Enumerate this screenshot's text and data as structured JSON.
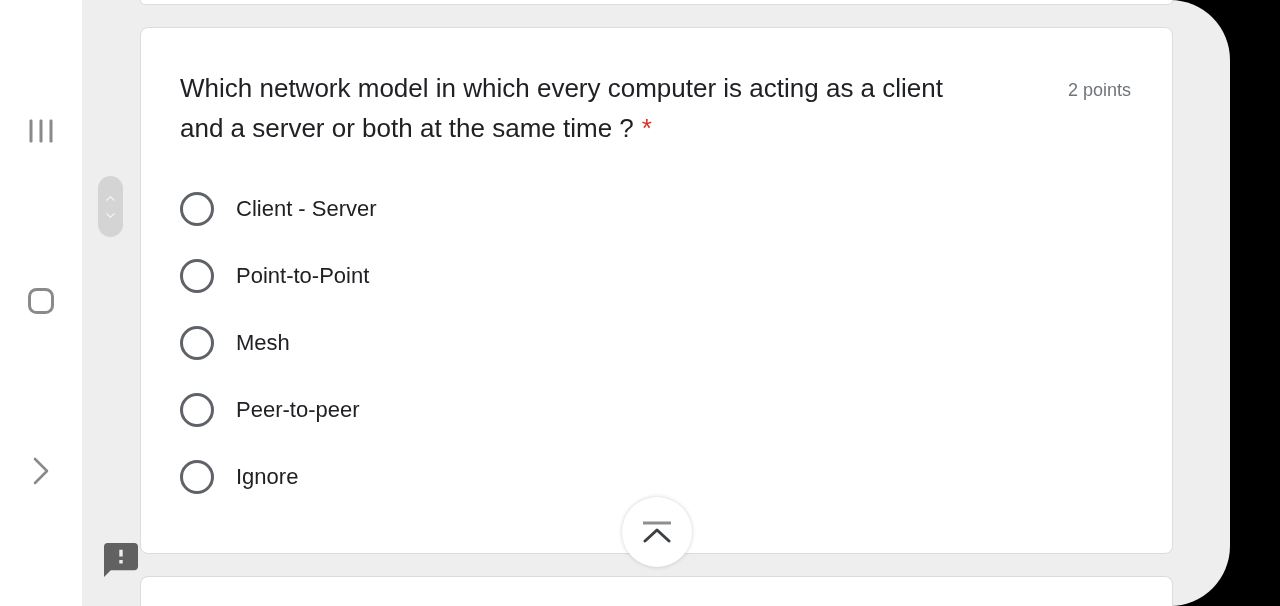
{
  "question": {
    "title": "Which network model in which every computer is acting as a client and a server or both at the same time ?",
    "required_mark": "*",
    "points": "2 points",
    "options": [
      {
        "label": "Client - Server",
        "selected": false
      },
      {
        "label": "Point-to-Point",
        "selected": false
      },
      {
        "label": "Mesh",
        "selected": false
      },
      {
        "label": "Peer-to-peer",
        "selected": false
      },
      {
        "label": "Ignore",
        "selected": false
      }
    ]
  }
}
